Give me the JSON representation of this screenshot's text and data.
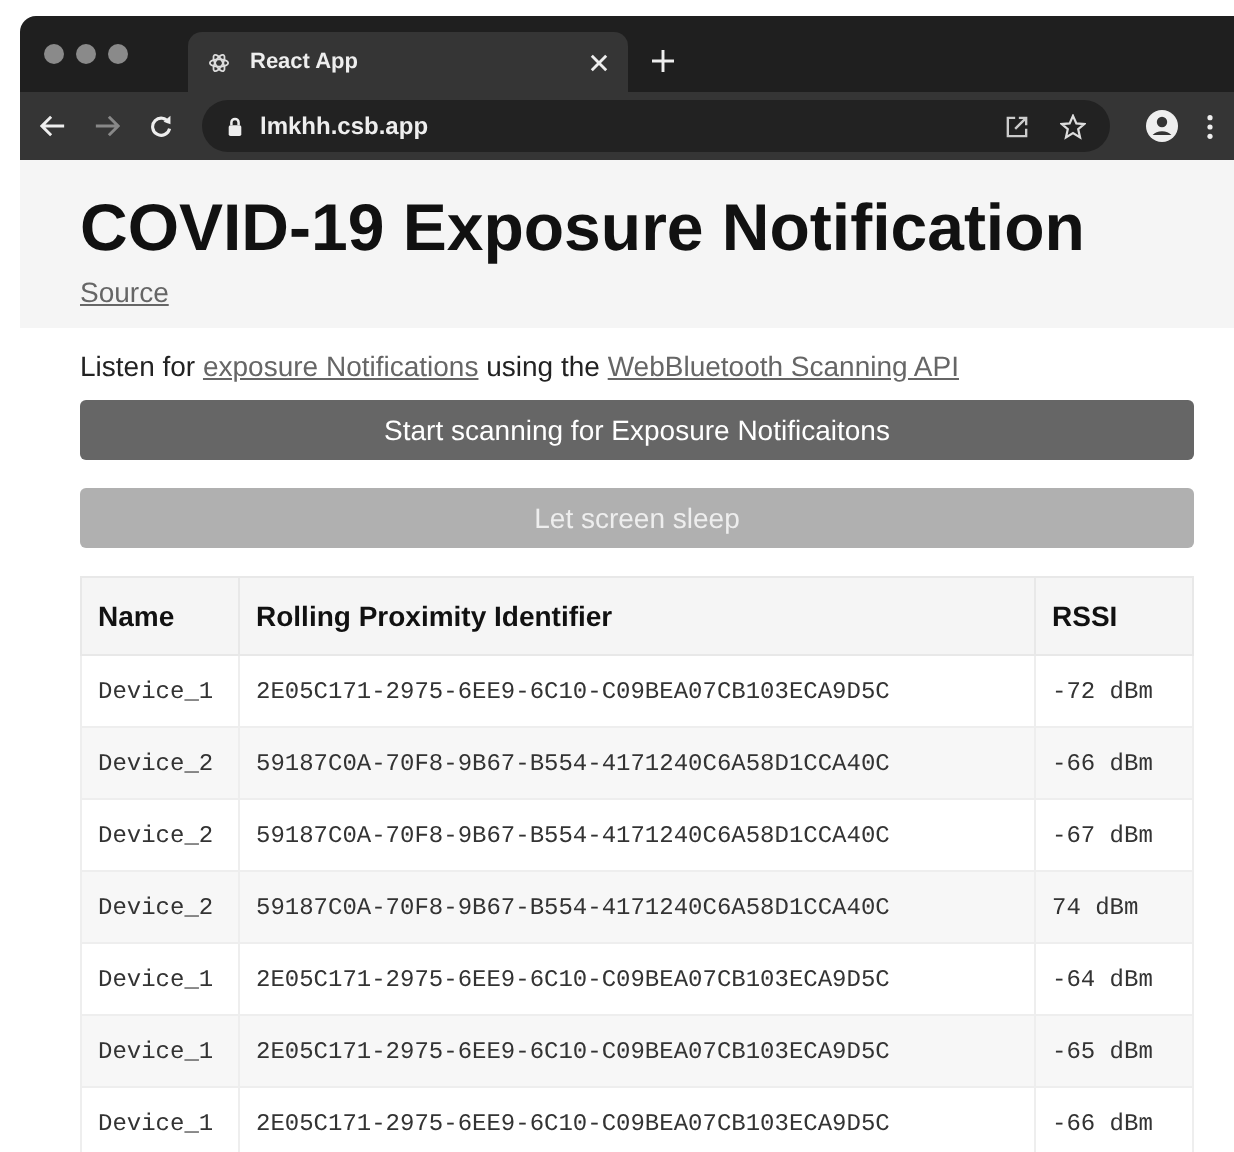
{
  "browser": {
    "tab_title": "React App",
    "url": "lmkhh.csb.app"
  },
  "page": {
    "title": "COVID-19 Exposure Notification",
    "source_link": "Source",
    "intro": [
      {
        "kind": "text",
        "text": "Listen for "
      },
      {
        "kind": "link",
        "text": "exposure Notifications"
      },
      {
        "kind": "text",
        "text": " using the "
      },
      {
        "kind": "link",
        "text": "WebBluetooth Scanning API"
      }
    ],
    "buttons": [
      {
        "label": "Start scanning for Exposure Notificaitons",
        "disabled": false
      },
      {
        "label": "Let screen sleep",
        "disabled": true
      }
    ]
  },
  "table": {
    "columns": [
      "Name",
      "Rolling Proximity Identifier",
      "RSSI"
    ],
    "rows": [
      [
        "Device_1",
        "2E05C171-2975-6EE9-6C10-C09BEA07CB103ECA9D5C",
        "-72 dBm"
      ],
      [
        "Device_2",
        "59187C0A-70F8-9B67-B554-4171240C6A58D1CCA40C",
        "-66 dBm"
      ],
      [
        "Device_2",
        "59187C0A-70F8-9B67-B554-4171240C6A58D1CCA40C",
        "-67 dBm"
      ],
      [
        "Device_2",
        "59187C0A-70F8-9B67-B554-4171240C6A58D1CCA40C",
        "74 dBm"
      ],
      [
        "Device_1",
        "2E05C171-2975-6EE9-6C10-C09BEA07CB103ECA9D5C",
        "-64 dBm"
      ],
      [
        "Device_1",
        "2E05C171-2975-6EE9-6C10-C09BEA07CB103ECA9D5C",
        "-65 dBm"
      ],
      [
        "Device_1",
        "2E05C171-2975-6EE9-6C10-C09BEA07CB103ECA9D5C",
        "-66 dBm"
      ]
    ]
  }
}
